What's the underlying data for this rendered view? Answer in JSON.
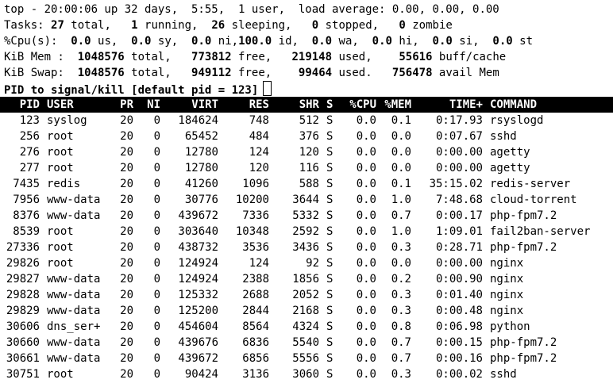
{
  "summary": {
    "line1": "top - 20:00:06 up 32 days,  5:55,  1 user,  load average: 0.00, 0.00, 0.00",
    "tasks": [
      "Tasks: ",
      "27",
      " total,   ",
      "1",
      " running,  ",
      "26",
      " sleeping,   ",
      "0",
      " stopped,   ",
      "0",
      " zombie"
    ],
    "cpu": [
      "%Cpu(s):  ",
      "0.0",
      " us,  ",
      "0.0",
      " sy,  ",
      "0.0",
      " ni,",
      "100.0",
      " id,  ",
      "0.0",
      " wa,  ",
      "0.0",
      " hi,  ",
      "0.0",
      " si,  ",
      "0.0",
      " st"
    ],
    "mem": [
      "KiB Mem :  ",
      "1048576",
      " total,   ",
      "773812",
      " free,   ",
      "219148",
      " used,    ",
      "55616",
      " buff/cache"
    ],
    "swap": [
      "KiB Swap:  ",
      "1048576",
      " total,   ",
      "949112",
      " free,    ",
      "99464",
      " used.   ",
      "756478",
      " avail Mem"
    ]
  },
  "prompt": "PID to signal/kill [default pid = 123]",
  "header": {
    "pid": "PID",
    "user": "USER",
    "pr": "PR",
    "ni": "NI",
    "virt": "VIRT",
    "res": "RES",
    "shr": "SHR",
    "s": "S",
    "cpu": "%CPU",
    "mem": "%MEM",
    "time": "TIME+",
    "command": "COMMAND"
  },
  "processes": [
    {
      "pid": "123",
      "user": "syslog",
      "pr": "20",
      "ni": "0",
      "virt": "184624",
      "res": "748",
      "shr": "512",
      "s": "S",
      "cpu": "0.0",
      "mem": "0.1",
      "time": "0:17.93",
      "command": "rsyslogd"
    },
    {
      "pid": "256",
      "user": "root",
      "pr": "20",
      "ni": "0",
      "virt": "65452",
      "res": "484",
      "shr": "376",
      "s": "S",
      "cpu": "0.0",
      "mem": "0.0",
      "time": "0:07.67",
      "command": "sshd"
    },
    {
      "pid": "276",
      "user": "root",
      "pr": "20",
      "ni": "0",
      "virt": "12780",
      "res": "124",
      "shr": "120",
      "s": "S",
      "cpu": "0.0",
      "mem": "0.0",
      "time": "0:00.00",
      "command": "agetty"
    },
    {
      "pid": "277",
      "user": "root",
      "pr": "20",
      "ni": "0",
      "virt": "12780",
      "res": "120",
      "shr": "116",
      "s": "S",
      "cpu": "0.0",
      "mem": "0.0",
      "time": "0:00.00",
      "command": "agetty"
    },
    {
      "pid": "7435",
      "user": "redis",
      "pr": "20",
      "ni": "0",
      "virt": "41260",
      "res": "1096",
      "shr": "588",
      "s": "S",
      "cpu": "0.0",
      "mem": "0.1",
      "time": "35:15.02",
      "command": "redis-server"
    },
    {
      "pid": "7956",
      "user": "www-data",
      "pr": "20",
      "ni": "0",
      "virt": "30776",
      "res": "10200",
      "shr": "3644",
      "s": "S",
      "cpu": "0.0",
      "mem": "1.0",
      "time": "7:48.68",
      "command": "cloud-torrent"
    },
    {
      "pid": "8376",
      "user": "www-data",
      "pr": "20",
      "ni": "0",
      "virt": "439672",
      "res": "7336",
      "shr": "5332",
      "s": "S",
      "cpu": "0.0",
      "mem": "0.7",
      "time": "0:00.17",
      "command": "php-fpm7.2"
    },
    {
      "pid": "8539",
      "user": "root",
      "pr": "20",
      "ni": "0",
      "virt": "303640",
      "res": "10348",
      "shr": "2592",
      "s": "S",
      "cpu": "0.0",
      "mem": "1.0",
      "time": "1:09.01",
      "command": "fail2ban-server"
    },
    {
      "pid": "27336",
      "user": "root",
      "pr": "20",
      "ni": "0",
      "virt": "438732",
      "res": "3536",
      "shr": "3436",
      "s": "S",
      "cpu": "0.0",
      "mem": "0.3",
      "time": "0:28.71",
      "command": "php-fpm7.2"
    },
    {
      "pid": "29826",
      "user": "root",
      "pr": "20",
      "ni": "0",
      "virt": "124924",
      "res": "124",
      "shr": "92",
      "s": "S",
      "cpu": "0.0",
      "mem": "0.0",
      "time": "0:00.00",
      "command": "nginx"
    },
    {
      "pid": "29827",
      "user": "www-data",
      "pr": "20",
      "ni": "0",
      "virt": "124924",
      "res": "2388",
      "shr": "1856",
      "s": "S",
      "cpu": "0.0",
      "mem": "0.2",
      "time": "0:00.90",
      "command": "nginx"
    },
    {
      "pid": "29828",
      "user": "www-data",
      "pr": "20",
      "ni": "0",
      "virt": "125332",
      "res": "2688",
      "shr": "2052",
      "s": "S",
      "cpu": "0.0",
      "mem": "0.3",
      "time": "0:01.40",
      "command": "nginx"
    },
    {
      "pid": "29829",
      "user": "www-data",
      "pr": "20",
      "ni": "0",
      "virt": "125200",
      "res": "2844",
      "shr": "2168",
      "s": "S",
      "cpu": "0.0",
      "mem": "0.3",
      "time": "0:00.48",
      "command": "nginx"
    },
    {
      "pid": "30606",
      "user": "dns_ser+",
      "pr": "20",
      "ni": "0",
      "virt": "454604",
      "res": "8564",
      "shr": "4324",
      "s": "S",
      "cpu": "0.0",
      "mem": "0.8",
      "time": "0:06.98",
      "command": "python"
    },
    {
      "pid": "30660",
      "user": "www-data",
      "pr": "20",
      "ni": "0",
      "virt": "439676",
      "res": "6836",
      "shr": "5540",
      "s": "S",
      "cpu": "0.0",
      "mem": "0.7",
      "time": "0:00.15",
      "command": "php-fpm7.2"
    },
    {
      "pid": "30661",
      "user": "www-data",
      "pr": "20",
      "ni": "0",
      "virt": "439672",
      "res": "6856",
      "shr": "5556",
      "s": "S",
      "cpu": "0.0",
      "mem": "0.7",
      "time": "0:00.16",
      "command": "php-fpm7.2"
    },
    {
      "pid": "30751",
      "user": "root",
      "pr": "20",
      "ni": "0",
      "virt": "90424",
      "res": "3136",
      "shr": "3060",
      "s": "S",
      "cpu": "0.0",
      "mem": "0.3",
      "time": "0:00.02",
      "command": "sshd"
    }
  ]
}
